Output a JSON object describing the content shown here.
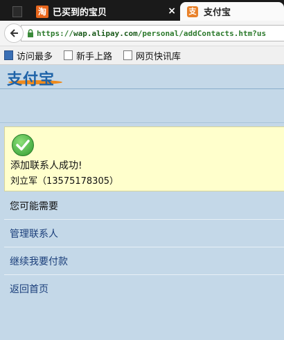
{
  "browser": {
    "tabs": [
      {
        "label": "已买到的宝贝",
        "favicon_text": "淘",
        "active": false
      },
      {
        "label": "支付宝",
        "favicon_text": "支",
        "active": true
      }
    ],
    "close_glyph": "×",
    "url_scheme": "https://",
    "url_host": "wap.alipay.com",
    "url_path": "/personal/addContacts.htm?us",
    "bookmarks": [
      {
        "label": "访问最多",
        "icon": "bookmark-star-icon"
      },
      {
        "label": "新手上路",
        "icon": "page-icon"
      },
      {
        "label": "网页快讯库",
        "icon": "page-icon"
      }
    ]
  },
  "header": {
    "logo_text": "支付宝"
  },
  "result": {
    "title": "添加联系人成功!",
    "contact": "刘立军（13575178305）"
  },
  "menu": {
    "section_label": "您可能需要",
    "links": [
      {
        "label": "管理联系人"
      },
      {
        "label": "继续我要付款"
      },
      {
        "label": "返回首页"
      }
    ]
  },
  "colors": {
    "page_bg": "#c4d8e8",
    "success_bg": "#ffffcc",
    "link": "#1a3e7a",
    "brand_orange": "#ef8a1b",
    "brand_blue": "#1f63a8"
  }
}
